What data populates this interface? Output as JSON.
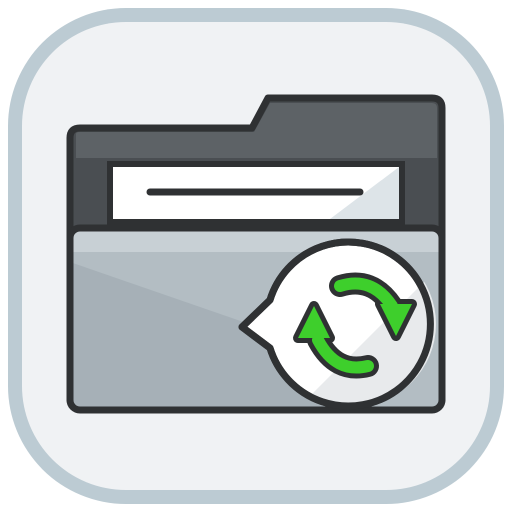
{
  "icon": {
    "name": "folder-sync-icon",
    "parts": [
      "folder-icon",
      "document-sheet",
      "speech-bubble",
      "sync-arrows-icon"
    ]
  },
  "colors": {
    "tile_border": "#bccbd3",
    "tile_fill": "#f0f2f4",
    "outline": "#2f3133",
    "folder_back": "#4a4e52",
    "folder_back_highlight": "#5d6266",
    "folder_front": "#b3bdc3",
    "folder_front_light": "#c8d0d5",
    "folder_front_dark": "#9aa6ad",
    "paper": "#ffffff",
    "paper_shade": "#dde4e8",
    "bubble": "#ffffff",
    "bubble_shade": "#e8eaec",
    "arrow_green": "#3ecf2c",
    "arrow_green_light": "#7ff04c"
  }
}
